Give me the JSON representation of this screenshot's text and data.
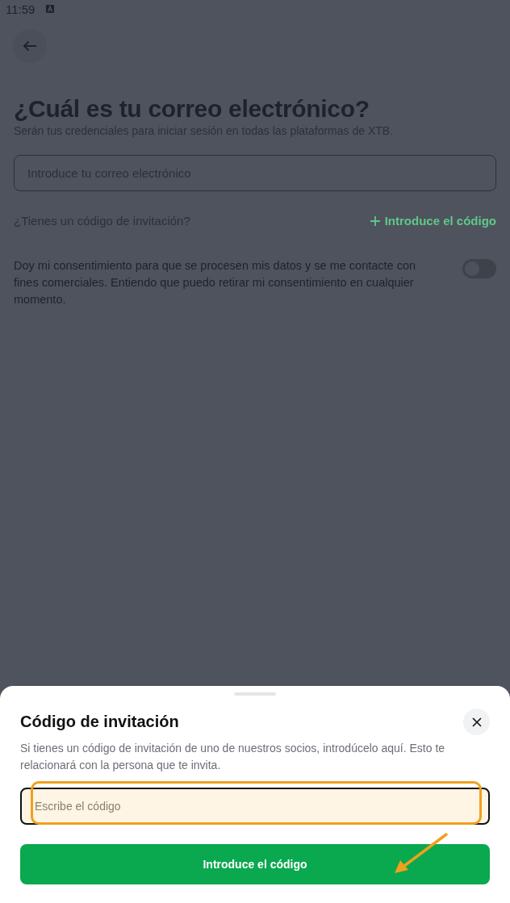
{
  "status_bar": {
    "time": "11:59"
  },
  "page": {
    "title": "¿Cuál es tu correo electrónico?",
    "subtitle": "Serán tus credenciales para iniciar sesión en todas las plataformas de XTB.",
    "email_field": {
      "placeholder": "Introduce tu correo electrónico"
    },
    "invitation_question": "¿Tienes un código de invitación?",
    "invitation_link": "Introduce el código",
    "consent": {
      "text": "Doy mi consentimiento para que se procesen mis datos y se me contacte con fines comerciales. Entiendo que puedo retirar mi consentimiento en cualquier momento.",
      "on": false
    }
  },
  "sheet": {
    "title": "Código de invitación",
    "description": "Si tienes un código de invitación de uno de nuestros socios, introdúcelo aquí. Esto te relacionará con la persona que te invita.",
    "code_field": {
      "placeholder": "Escribe el código",
      "highlighted": true
    },
    "button": "Introduce el código",
    "arrow": true
  }
}
